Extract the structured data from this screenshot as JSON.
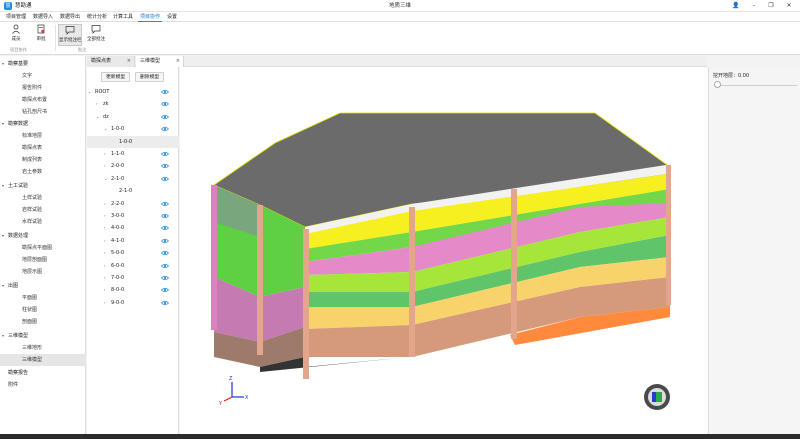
{
  "app": {
    "name": "慧勘通",
    "logo_glyph": "慧",
    "window_title": "地质三维"
  },
  "window_controls": {
    "user_glyph": "👤",
    "minimize": "–",
    "maximize": "❐",
    "close": "✕"
  },
  "menu": [
    "项目管理",
    "数据导入",
    "数据导出",
    "统计分析",
    "计算工具",
    "项目协作",
    "设置"
  ],
  "ribbon": {
    "buttons": [
      "成员",
      "审批",
      "显示批注栏",
      "全部批注"
    ],
    "groups": [
      "项目协作",
      "批注"
    ]
  },
  "sidebar": {
    "sections": [
      {
        "label": "勘察基要",
        "items": [
          "文字",
          "报告附件",
          "勘探点布置",
          "钻孔剖尺书"
        ]
      },
      {
        "label": "勘察数据",
        "items": [
          "标准地层",
          "勘探点表",
          "制成列表",
          "岩土参数"
        ]
      },
      {
        "label": "土工试验",
        "items": [
          "土样试验",
          "岩样试验",
          "水样试验"
        ]
      },
      {
        "label": "数据处理",
        "items": [
          "勘探点平面图",
          "地层剖面图",
          "地层示图"
        ]
      },
      {
        "label": "出图",
        "items": [
          "平面图",
          "柱状图",
          "剖面图"
        ]
      },
      {
        "label": "三维模型",
        "items": [
          "三维地形",
          "三维模型"
        ]
      }
    ],
    "extra": [
      "勘察报告",
      "附件"
    ],
    "selected": "三维模型"
  },
  "tabs": [
    {
      "label": "勘探点表",
      "close": "×"
    },
    {
      "label": "三维模型",
      "close": "×"
    }
  ],
  "tree": {
    "toolbar": [
      "更新模型",
      "删除模型"
    ],
    "nodes": [
      {
        "label": "ROOT",
        "caret": "⌄"
      },
      {
        "label": "zk",
        "caret": "›"
      },
      {
        "label": "dz",
        "caret": "⌄"
      },
      {
        "label": "1-0-0",
        "caret": "⌄"
      },
      {
        "label": "1-0-0",
        "caret": ""
      },
      {
        "label": "1-1-0",
        "caret": "›"
      },
      {
        "label": "2-0-0",
        "caret": "›"
      },
      {
        "label": "2-1-0",
        "caret": "⌄"
      },
      {
        "label": "2-1-0",
        "caret": ""
      },
      {
        "label": "2-2-0",
        "caret": "›"
      },
      {
        "label": "3-0-0",
        "caret": "›"
      },
      {
        "label": "4-0-0",
        "caret": "›"
      },
      {
        "label": "4-1-0",
        "caret": "›"
      },
      {
        "label": "5-0-0",
        "caret": "›"
      },
      {
        "label": "6-0-0",
        "caret": "›"
      },
      {
        "label": "7-0-0",
        "caret": "›"
      },
      {
        "label": "8-0-0",
        "caret": "›"
      },
      {
        "label": "9-0-0",
        "caret": "›"
      }
    ]
  },
  "right_panel": {
    "label": "挖开地层：0.00",
    "slider_value": 0
  },
  "axes_labels": {
    "x": "X",
    "y": "Y",
    "z": "Z"
  },
  "colors": {
    "accent": "#1f8ce0",
    "top_surface": "#6b6b6b",
    "layer_yellow": "#f6f020",
    "layer_green": "#72d84a",
    "layer_pink": "#e58ac8",
    "layer_lime": "#a6e53a",
    "layer_sand": "#f8d36b",
    "layer_clay": "#d59a7c",
    "layer_orange": "#ff8a3c",
    "borehole": "#e3a58c"
  }
}
